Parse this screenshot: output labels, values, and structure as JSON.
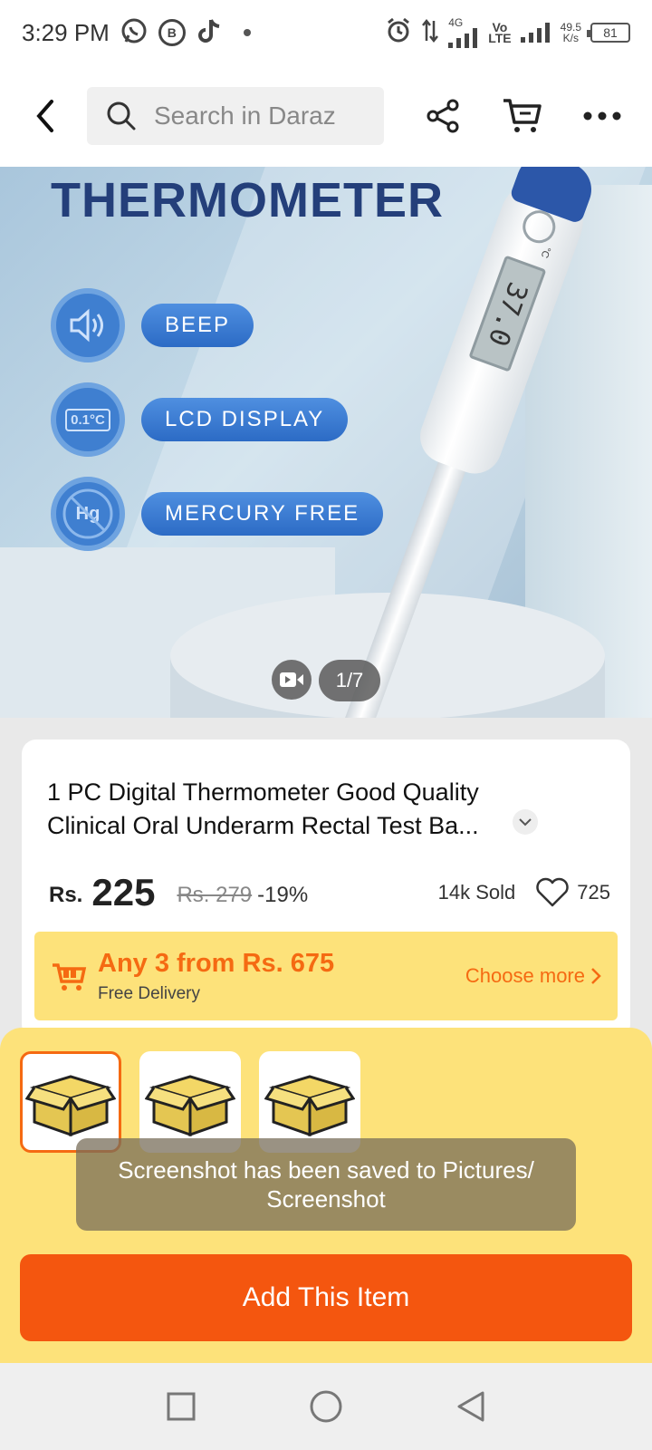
{
  "status_bar": {
    "time": "3:29 PM",
    "speed_value": "49.5",
    "speed_unit": "K/s",
    "battery": "81",
    "network_label": "4G",
    "volte_label_top": "Vo",
    "volte_label_bottom": "LTE",
    "icons": [
      "whatsapp-icon",
      "b-app-icon",
      "tiktok-icon",
      "alarm-icon",
      "data-arrows-icon",
      "signal-icon",
      "battery-icon"
    ]
  },
  "header": {
    "search_placeholder": "Search in Daraz",
    "icons": [
      "back-icon",
      "search-icon",
      "share-icon",
      "cart-icon",
      "more-icon"
    ]
  },
  "gallery": {
    "title": "THERMOMETER",
    "features": [
      {
        "label": "BEEP",
        "icon": "speaker-icon",
        "icon_text": ""
      },
      {
        "label": "LCD DISPLAY",
        "icon": "temperature-display-icon",
        "icon_text": "0.1°C"
      },
      {
        "label": "MERCURY FREE",
        "icon": "no-mercury-icon",
        "icon_text": "Hg"
      }
    ],
    "lcd_reading": "37.0",
    "lcd_unit": "°C",
    "counter": "1/7"
  },
  "product": {
    "title": "1 PC Digital Thermometer Good Quality Clinical Oral Underarm Rectal Test Ba...",
    "currency": "Rs.",
    "price": "225",
    "original_price": "Rs. 279",
    "discount": "-19%",
    "sold": "14k Sold",
    "wishlist_count": "725"
  },
  "promo": {
    "title": "Any 3 from Rs. 675",
    "subtitle": "Free Delivery",
    "link": "Choose more"
  },
  "sheet": {
    "toast": "Screenshot has been saved to  Pictures/ Screenshot",
    "add_button": "Add This Item",
    "thumbnails": 3
  },
  "colors": {
    "accent_orange": "#f4560f",
    "promo_yellow": "#fde27a",
    "title_blue": "#243f7a"
  }
}
